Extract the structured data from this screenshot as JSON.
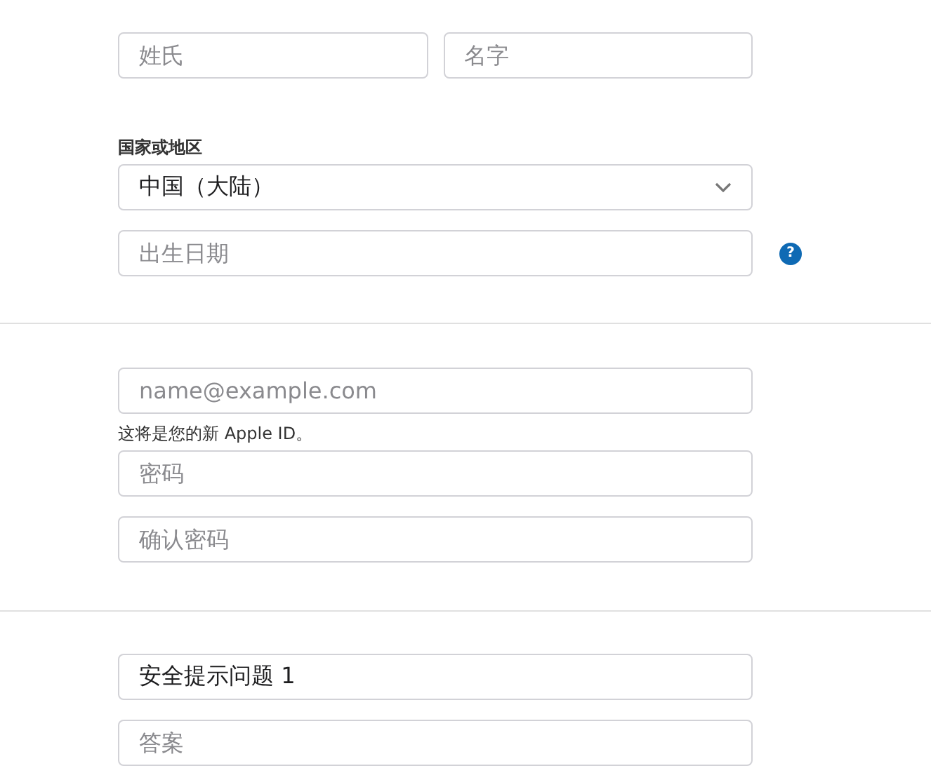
{
  "name_fields": [
    {
      "placeholder": "姓氏"
    },
    {
      "placeholder": "名字"
    }
  ],
  "region": {
    "label": "国家或地区",
    "value": "中国（大陆）"
  },
  "birthday": {
    "placeholder": "出生日期",
    "help": "?"
  },
  "email": {
    "placeholder": "name@example.com",
    "hint": "这将是您的新 Apple ID。"
  },
  "passwords": [
    {
      "placeholder": "密码"
    },
    {
      "placeholder": "确认密码"
    }
  ],
  "security": [
    {
      "kind": "select",
      "value": "安全提示问题 1"
    },
    {
      "kind": "text",
      "placeholder": "答案"
    }
  ]
}
